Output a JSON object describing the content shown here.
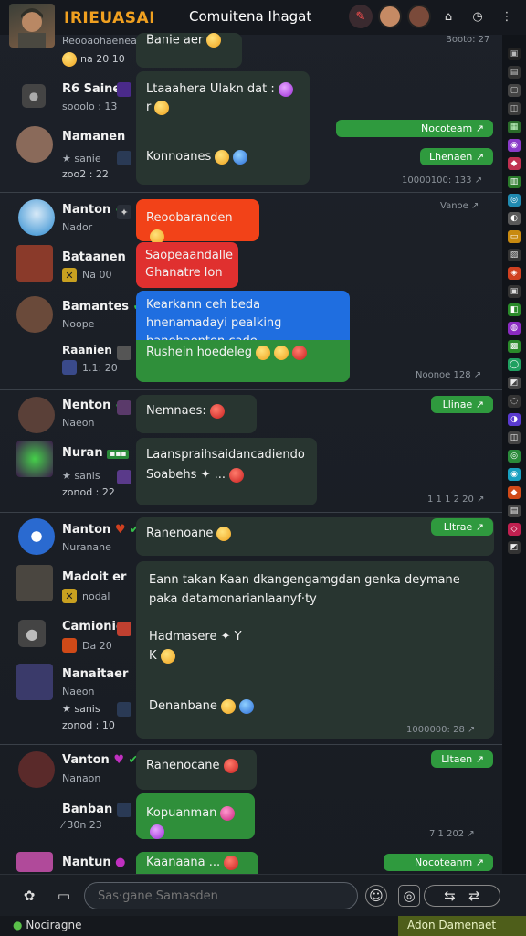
{
  "header": {
    "brand": "IRIEUASAI",
    "channel_title": "Comuitena Ihagat"
  },
  "composer": {
    "placeholder": "Sas·gane Samasden"
  },
  "statusbar": {
    "left": "Nociragne",
    "right": "Adon Damenaet"
  },
  "pills": {
    "p1": "Nocoteam ↗",
    "p2": "Lhenaen ↗",
    "p3": "Llinae ↗",
    "p4": "Lltrae ↗",
    "p5": "Lltaen ↗",
    "p6": "Nocoteanm ↗"
  },
  "times": {
    "t0": "Booto: 27",
    "t1": "10000100: 133 ↗",
    "t2": "Vanoe ↗",
    "t3": "Noonoe 128 ↗",
    "t4": "1 1 1 2 20 ↗",
    "t5": "1000000: 28 ↗",
    "t6": "7 1 202 ↗"
  },
  "users": [
    {
      "name": "",
      "sub": "Reooaohaenea",
      "stat": "na 20 10"
    },
    {
      "name": "R6 Saine",
      "sub": "sooolo : 13"
    },
    {
      "name": "Namanen",
      "sub": "★ sanie",
      "stat": "zoo2 : 22"
    },
    {
      "name": "Nanton",
      "sub": "Nador"
    },
    {
      "name": "Bataanen",
      "sub": "Na 00"
    },
    {
      "name": "Bamantes",
      "sub": "Noope"
    },
    {
      "name": "Raanien",
      "sub": "1.1: 20"
    },
    {
      "name": "Nenton",
      "sub": "Naeon"
    },
    {
      "name": "Nuran",
      "sub": "★ sanis",
      "stat": "zonod : 22"
    },
    {
      "name": "Nanton",
      "sub": "Nuranane"
    },
    {
      "name": "Madoit er",
      "sub": "nodal"
    },
    {
      "name": "Camionie",
      "sub": "Da 20"
    },
    {
      "name": "Nanaitaer",
      "sub": "Naeon",
      "stat": "★ sanis",
      "stat2": "zonod : 10"
    },
    {
      "name": "Vanton",
      "sub": "Nanaon"
    },
    {
      "name": "Banban",
      "sub": "30n 23"
    },
    {
      "name": "Nantun",
      "sub": ""
    }
  ],
  "messages": {
    "m0": "Banie aer",
    "m1": "Ltaaahera Ulakn dat :",
    "m1b": "r",
    "m2": "Konnoanes",
    "m3": "Reoobaranden",
    "m4": "Saopeaandalle Ghanatre lon",
    "m5": "Kearkann ceh beda hnenamadayi pealking banehaenten cade.",
    "m6": "Rushein hoedeleg",
    "m7": "Nemnaes:",
    "m8": "Laanspraihsaidancadiendo Soabehs ✦ ...",
    "m9": "Ranenoane",
    "m10": "Eann takan Kaan dkangengamgdan genka deymane paka datamonarianlaanyf·ty",
    "m11": "Hadmasere ✦ Y",
    "m11b": "K",
    "m12": "Denanbane",
    "m13": "Ranenocane",
    "m14": "Kopuanman",
    "m15": "Kaanaana ..."
  },
  "colors": {
    "accent_green": "#2f8f3a",
    "accent_red": "#e0302f",
    "accent_orange": "#f24218",
    "accent_blue": "#1f6ee0",
    "brand": "#f0a020"
  }
}
